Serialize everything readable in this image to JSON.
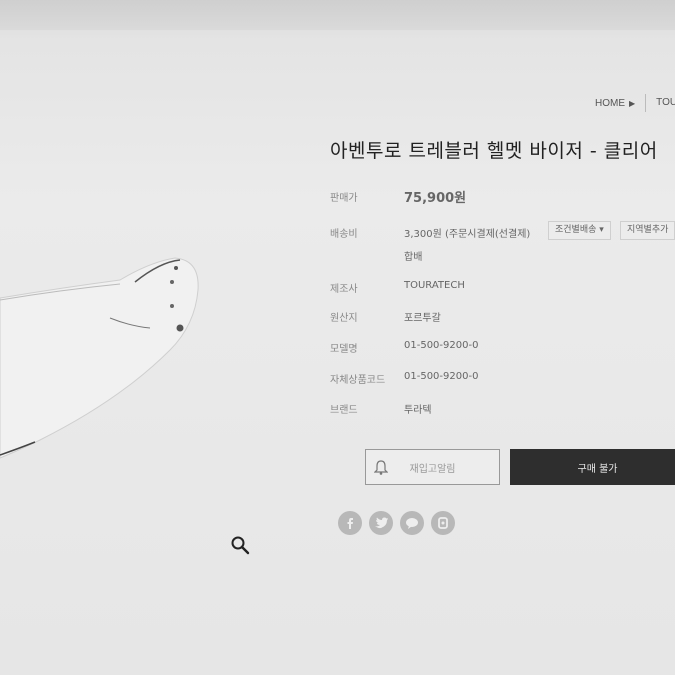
{
  "breadcrumb": {
    "home": "HOME",
    "separator": "▶",
    "category": "TOU"
  },
  "product": {
    "title": "아벤투로 트레블러 헬멧 바이저 - 클리어",
    "price_label": "판매가",
    "price_value": "75,900원",
    "shipping_label": "배송비",
    "shipping_value": "3,300원  (주문시결제(선결제)",
    "shipping_option_1": "조건별배송",
    "shipping_option_2": "지역별추가",
    "shipping_note": "합배",
    "maker_label": "제조사",
    "maker_value": "TOURATECH",
    "origin_label": "원산지",
    "origin_value": "포르투갈",
    "model_label": "모델명",
    "model_value": "01-500-9200-0",
    "code_label": "자체상품코드",
    "code_value": "01-500-9200-0",
    "brand_label": "브랜드",
    "brand_value": "투라텍"
  },
  "actions": {
    "restock_label": "재입고알림",
    "buy_label": "구매 불가"
  },
  "icons": {
    "social": [
      "facebook-icon",
      "twitter-icon",
      "kakao-icon",
      "band-icon"
    ],
    "zoom": "search-icon",
    "bell": "bell-icon"
  },
  "colors": {
    "buy_button": "#2e2e2e",
    "social": "#b8b8b8"
  }
}
